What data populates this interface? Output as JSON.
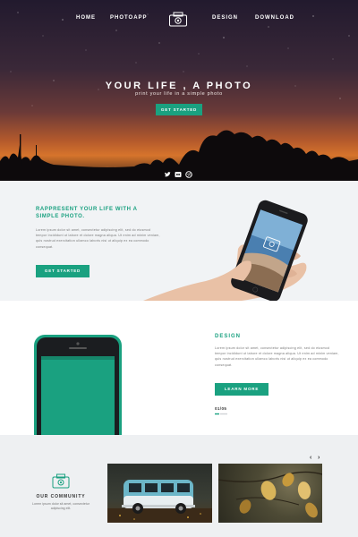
{
  "nav": {
    "items": [
      "HOME",
      "PHOTOAPP",
      "DESIGN",
      "DOWNLOAD"
    ],
    "logo_icon": "camera-icon"
  },
  "hero": {
    "title": "YOUR LIFE , A PHOTO",
    "subtitle": "print your life in a simple photo",
    "button": "GET STARTED",
    "social_icons": [
      "twitter-icon",
      "flickr-icon",
      "dribbble-icon"
    ]
  },
  "section_intro": {
    "title": "RAPPRESENT YOUR LIFE WITH A SIMPLE PHOTO.",
    "text": "Lorem ipsum dolor sit amet, consectetur adipiscing elit, sed do eiusmod tempor incididunt ut labore et dolore magna aliqua. Ut enim ad minim veniam, quis nostrud exercitation ullamco laboris nisi ut aliquip ex ea commodo consequat.",
    "button": "GET STARTED"
  },
  "section_design": {
    "title": "DESIGN",
    "text": "Lorem ipsum dolor sit amet, consectetur adipiscing elit, sed do eiusmod tempor incididunt ut labore et dolore magna aliqua. Ut enim ad minim veniam, quis nostrud exercitation ullamco laboris nisi ut aliquip ex ea commodo consequat.",
    "button": "LEARN MORE",
    "pager": "01/05"
  },
  "community": {
    "title": "OUR COMMUNITY",
    "text": "Lorem ipsum dolor sit amet, consectetur adipiscing elit.",
    "prev": "‹",
    "next": "›"
  },
  "colors": {
    "accent": "#1aa180",
    "light_bg": "#f1f3f5"
  }
}
